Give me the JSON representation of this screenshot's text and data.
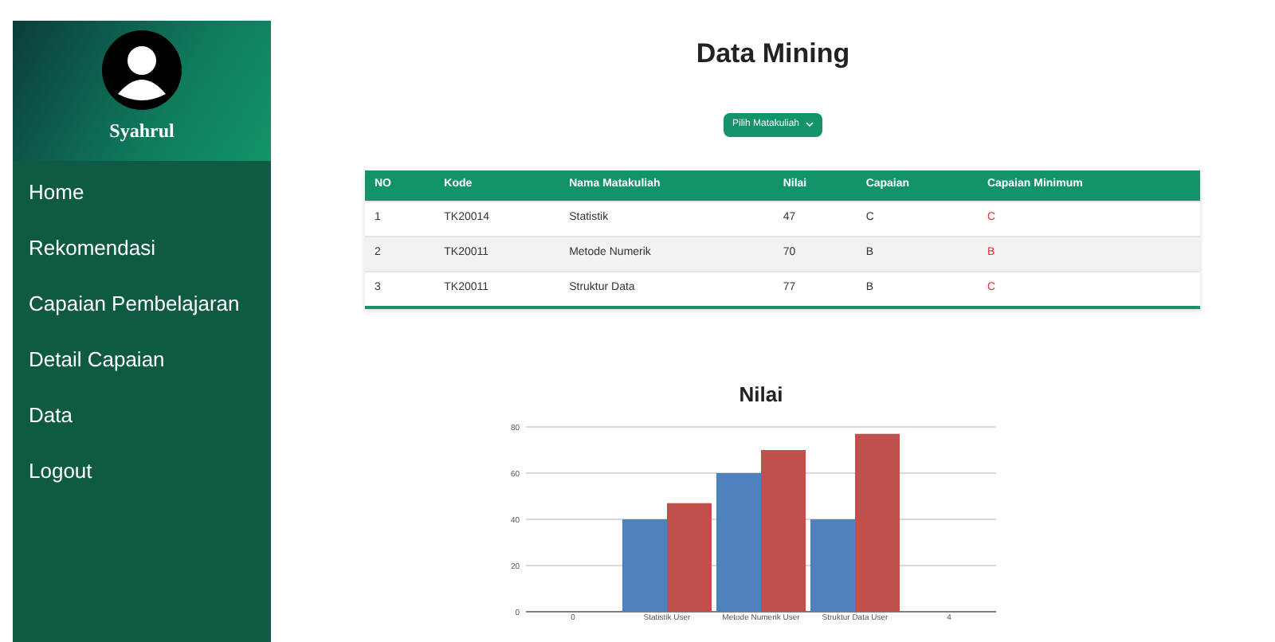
{
  "sidebar": {
    "user": {
      "name": "Syahrul"
    },
    "items": [
      {
        "label": "Home",
        "selected": false
      },
      {
        "label": "Rekomendasi",
        "selected": false
      },
      {
        "label": "Capaian Pembelajaran",
        "selected": false
      },
      {
        "label": "Detail Capaian",
        "selected": false
      },
      {
        "label": "Data",
        "selected": false
      },
      {
        "label": "Logout",
        "selected": false
      }
    ]
  },
  "page": {
    "title": "Data Mining",
    "dropdown": {
      "label": "Pilih Matakuliah"
    }
  },
  "table": {
    "columns": [
      "NO",
      "Kode",
      "Nama Matakuliah",
      "Nilai",
      "Capaian",
      "Capaian Minimum"
    ],
    "rows": [
      [
        "1",
        "TK20014",
        "Statistik",
        "47",
        "C",
        "C"
      ],
      [
        "2",
        "TK20011",
        "Metode Numerik",
        "70",
        "B",
        "B"
      ],
      [
        "3",
        "TK20011",
        "Struktur Data",
        "77",
        "B",
        "C"
      ]
    ]
  },
  "chart": {
    "chart_data": {
      "type": "bar",
      "title": "Nilai",
      "categories": [
        "0",
        "Statistik User",
        "Metode Numerik User",
        "Struktur Data User",
        "4"
      ],
      "series": [
        {
          "color": "#4f81bd",
          "values": [
            null,
            40,
            60,
            40,
            null
          ]
        },
        {
          "color": "#c0504d",
          "values": [
            null,
            47,
            70,
            77,
            null
          ]
        }
      ],
      "grid": true,
      "ylim": [
        0,
        80
      ],
      "yticks": [
        0,
        20,
        40,
        60,
        80
      ]
    }
  }
}
